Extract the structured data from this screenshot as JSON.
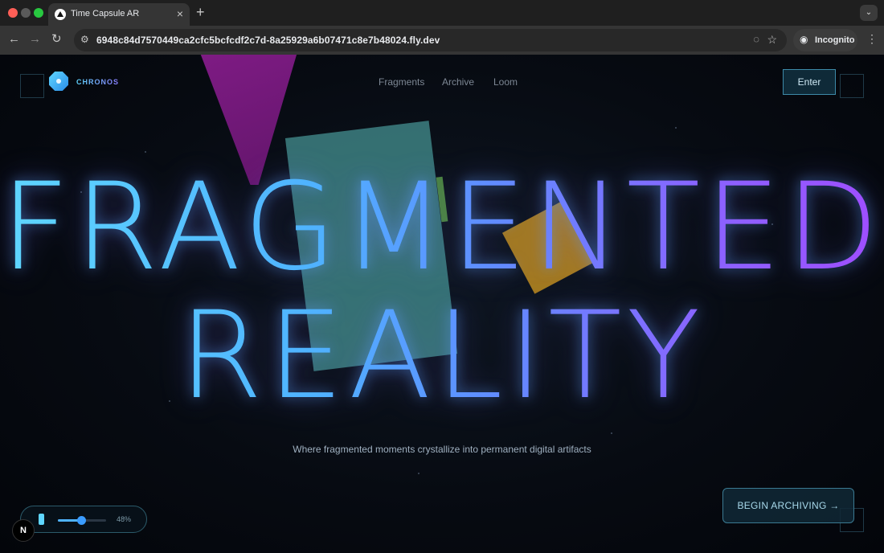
{
  "browser": {
    "tab_title": "Time Capsule AR",
    "tab_close": "×",
    "new_tab": "+",
    "tabs_menu": "⌄",
    "url": "6948c84d7570449ca2cfc5bcfcdf2c7d-8a25929a6b07471c8e7b48024.fly.dev",
    "incognito_label": "Incognito",
    "icons": [
      "back-arrow-icon",
      "forward-arrow-icon",
      "reload-icon",
      "site-info-icon",
      "eye-off-icon",
      "star-icon",
      "incognito-icon",
      "kebab-menu-icon"
    ]
  },
  "nav": {
    "brand": "CHRONOS",
    "links": [
      "Fragments",
      "Archive",
      "Loom"
    ],
    "enter_label": "Enter"
  },
  "hero": {
    "line1": "FRAGMENTED",
    "line2": "REALITY",
    "subtitle": "Where fragmented moments crystallize into permanent digital artifacts"
  },
  "cta": {
    "begin_label": "BEGIN ARCHIVING →"
  },
  "controls": {
    "level_percent": 48,
    "level_label": "48%",
    "dev_badge": "N"
  },
  "colors": {
    "accent_cyan": "#5fd6ff",
    "accent_violet": "#a04dff",
    "background": "#05070c"
  }
}
